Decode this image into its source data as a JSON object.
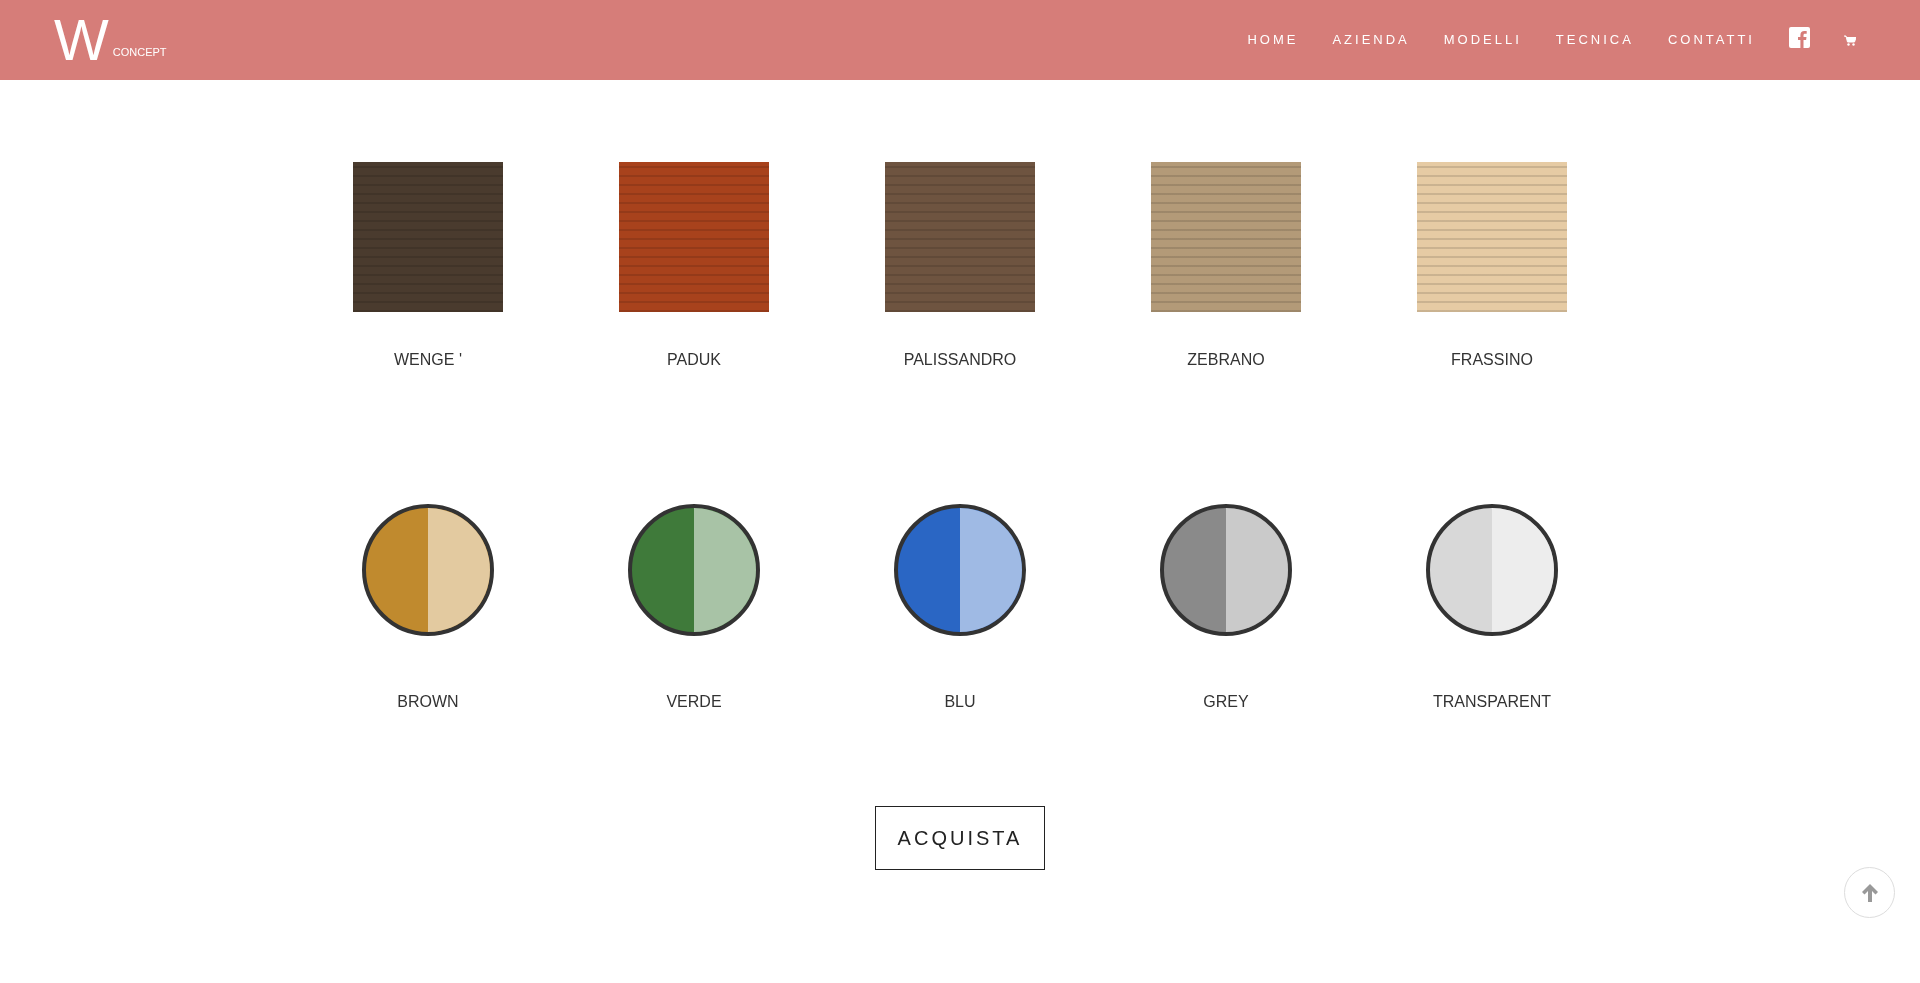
{
  "header": {
    "logo": {
      "mark": "W",
      "word": "CONCEPT"
    },
    "nav": [
      {
        "label": "HOME"
      },
      {
        "label": "AZIENDA"
      },
      {
        "label": "MODELLI"
      },
      {
        "label": "TECNICA"
      },
      {
        "label": "CONTATTI"
      }
    ]
  },
  "woods": [
    {
      "name": "WENGE '",
      "color": "#4a3b2e"
    },
    {
      "name": "PADUK",
      "color": "#a8421c"
    },
    {
      "name": "PALISSANDRO",
      "color": "#6e5440"
    },
    {
      "name": "ZEBRANO",
      "color": "#b39a78"
    },
    {
      "name": "FRASSINO",
      "color": "#e6cba4"
    }
  ],
  "glasses": [
    {
      "name": "BROWN",
      "color": "#c08a2e"
    },
    {
      "name": "VERDE",
      "color": "#3f7a3a"
    },
    {
      "name": "BLU",
      "color": "#2a66c4"
    },
    {
      "name": "GREY",
      "color": "#8a8a8a"
    },
    {
      "name": "TRANSPARENT",
      "color": "#d8d8d8"
    }
  ],
  "buy_button": "ACQUISTA"
}
